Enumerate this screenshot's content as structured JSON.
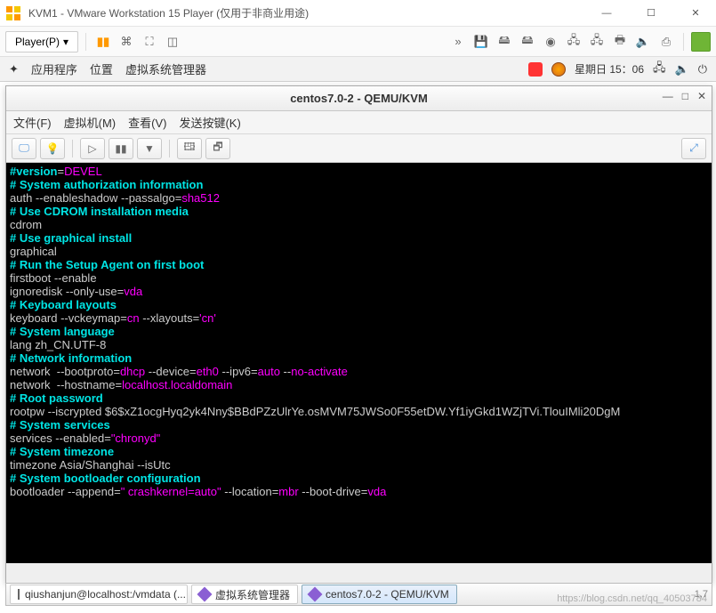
{
  "vmware": {
    "title": "KVM1 - VMware Workstation 15 Player (仅用于非商业用途)",
    "player_button": "Player(P)"
  },
  "gnome": {
    "apps": "应用程序",
    "places": "位置",
    "virtmgr": "虚拟系统管理器",
    "day_time": "星期日 15：06"
  },
  "qemu": {
    "title": "centos7.0-2 - QEMU/KVM",
    "menu": {
      "file": "文件(F)",
      "vm": "虚拟机(M)",
      "view": "查看(V)",
      "sendkey": "发送按键(K)"
    }
  },
  "terminal_lines": [
    [
      [
        "c-cyan",
        "#version"
      ],
      [
        "c-wht",
        "="
      ],
      [
        "c-mag",
        "DEVEL"
      ]
    ],
    [
      [
        "c-cyan",
        "# System authorization information"
      ]
    ],
    [
      [
        "c-wht",
        "auth --enableshadow --passalgo="
      ],
      [
        "c-mag",
        "sha512"
      ]
    ],
    [
      [
        "c-cyan",
        "# Use CDROM installation media"
      ]
    ],
    [
      [
        "c-wht",
        "cdrom"
      ]
    ],
    [
      [
        "c-cyan",
        "# Use graphical install"
      ]
    ],
    [
      [
        "c-wht",
        "graphical"
      ]
    ],
    [
      [
        "c-cyan",
        "# Run the Setup Agent on first boot"
      ]
    ],
    [
      [
        "c-wht",
        "firstboot --enable"
      ]
    ],
    [
      [
        "c-wht",
        "ignoredisk --only-use="
      ],
      [
        "c-mag",
        "vda"
      ]
    ],
    [
      [
        "c-cyan",
        "# Keyboard layouts"
      ]
    ],
    [
      [
        "c-wht",
        "keyboard --vckeymap="
      ],
      [
        "c-mag",
        "cn"
      ],
      [
        "c-wht",
        " --xlayouts="
      ],
      [
        "c-mag",
        "'cn'"
      ]
    ],
    [
      [
        "c-cyan",
        "# System language"
      ]
    ],
    [
      [
        "c-wht",
        "lang zh_CN.UTF-8"
      ]
    ],
    [
      [
        "c-wht",
        ""
      ]
    ],
    [
      [
        "c-cyan",
        "# Network information"
      ]
    ],
    [
      [
        "c-wht",
        "network  --bootproto="
      ],
      [
        "c-mag",
        "dhcp"
      ],
      [
        "c-wht",
        " --device="
      ],
      [
        "c-mag",
        "eth0"
      ],
      [
        "c-wht",
        " --ipv6="
      ],
      [
        "c-mag",
        "auto"
      ],
      [
        "c-wht",
        " --"
      ],
      [
        "c-mag",
        "no-activate"
      ]
    ],
    [
      [
        "c-wht",
        "network  --hostname="
      ],
      [
        "c-mag",
        "localhost.localdomain"
      ]
    ],
    [
      [
        "c-wht",
        ""
      ]
    ],
    [
      [
        "c-cyan",
        "# Root password"
      ]
    ],
    [
      [
        "c-wht",
        "rootpw --iscrypted $6$xZ1ocgHyq2yk4Nny$BBdPZzUlrYe.osMVM75JWSo0F55etDW.Yf1iyGkd1WZjTVi.TlouIMli20DgM"
      ]
    ],
    [
      [
        "c-cyan",
        "# System services"
      ]
    ],
    [
      [
        "c-wht",
        "services --enabled="
      ],
      [
        "c-mag",
        "\"chronyd\""
      ]
    ],
    [
      [
        "c-cyan",
        "# System timezone"
      ]
    ],
    [
      [
        "c-wht",
        "timezone Asia/Shanghai --isUtc"
      ]
    ],
    [
      [
        "c-cyan",
        "# System bootloader configuration"
      ]
    ],
    [
      [
        "c-wht",
        "bootloader --append="
      ],
      [
        "c-mag",
        "\" crashkernel=auto\""
      ],
      [
        "c-wht",
        " --location="
      ],
      [
        "c-mag",
        "mbr"
      ],
      [
        "c-wht",
        " --boot-drive="
      ],
      [
        "c-mag",
        "vda"
      ]
    ]
  ],
  "taskbar": {
    "t1": "qiushanjun@localhost:/vmdata (...",
    "t2": "虚拟系统管理器",
    "t3": "centos7.0-2 - QEMU/KVM"
  },
  "watermark": "https://blog.csdn.net/qq_40503784",
  "pager": "1,7"
}
